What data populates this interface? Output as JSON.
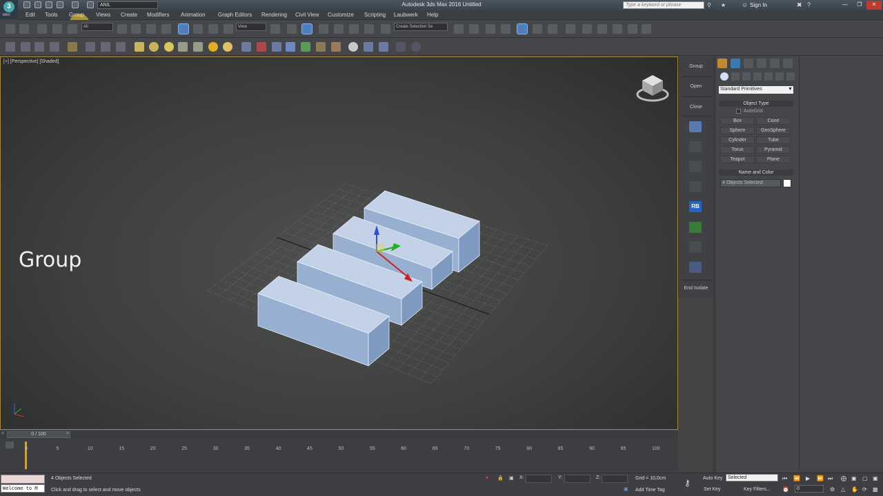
{
  "app": {
    "title": "Autodesk 3ds Max 2016      Untitled",
    "logo": "MAX",
    "workspace": "ANIL",
    "search_placeholder": "Type a keyword or phrase",
    "sign_in": "Sign In"
  },
  "menu": [
    "Edit",
    "Tools",
    "Group",
    "Views",
    "Create",
    "Modifiers",
    "Animation",
    "Graph Editors",
    "Rendering",
    "Civil View",
    "Customize",
    "Scripting",
    "Laubwerk",
    "Help"
  ],
  "toolbar": {
    "filter_value": "All",
    "ref_coord_value": "View",
    "selection_set_placeholder": "Create Selection Se"
  },
  "viewport": {
    "label": "[+] [Perspective] [Shaded]",
    "caption": "Group"
  },
  "group_panel": {
    "group": "Group",
    "open": "Open",
    "close": "Close",
    "rb": "RB",
    "end_isolate": "End Isolate"
  },
  "command_panel": {
    "category": "Standard Primitives",
    "object_type_title": "Object Type",
    "autogrid": "AutoGrid",
    "primitives": [
      "Box",
      "Cone",
      "Sphere",
      "GeoSphere",
      "Cylinder",
      "Tube",
      "Torus",
      "Pyramid",
      "Teapot",
      "Plane"
    ],
    "name_color_title": "Name and Color",
    "name_value": "4 Objects Selected"
  },
  "timeline": {
    "slider_label": "0 / 100",
    "ticks": [
      "0",
      "5",
      "10",
      "15",
      "20",
      "25",
      "30",
      "35",
      "40",
      "45",
      "50",
      "55",
      "60",
      "65",
      "70",
      "75",
      "80",
      "85",
      "90",
      "95",
      "100"
    ]
  },
  "status": {
    "maxscript_text": "Welcome to M",
    "selection_status": "4 Objects Selected",
    "prompt": "Click and drag to select and move objects",
    "x_label": "X:",
    "y_label": "Y:",
    "z_label": "Z:",
    "grid": "Grid = 10,0cm",
    "add_time_tag": "Add Time Tag",
    "auto_key": "Auto Key",
    "set_key": "Set Key",
    "key_mode_value": "Selected",
    "key_filters": "Key Filters...",
    "frame_value": "0"
  }
}
